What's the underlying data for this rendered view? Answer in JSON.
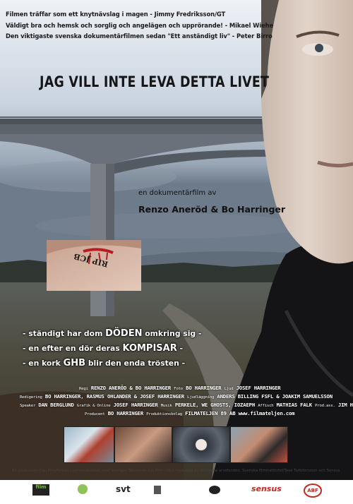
{
  "poster": {
    "quotes": [
      "Filmen träffar som ett knytnävslag i magen - Jimmy Fredriksson/GT",
      "Väldigt bra och hemsk och sorglig och angelägen och upprörande! - Mikael Wiehe",
      "Den viktigaste svenska dokumentärfilmen sedan \"Ett anständigt liv\" - Peter Birro"
    ],
    "title": "Jag vill inte leva detta livet",
    "subtitle": "en dokumentärfilm av",
    "directors": "Renzo Aneröd & Bo Harringer",
    "tattoo_text": "RIP JCB",
    "taglines": [
      {
        "pre": "- ständigt har dom ",
        "hl": "DÖDEN",
        "post": " omkring sig -"
      },
      {
        "pre": "- en efter en dör deras ",
        "hl": "KOMPISAR",
        "post": " -"
      },
      {
        "pre": "- en kork ",
        "hl": "GHB",
        "post": " blir den enda trösten -"
      }
    ],
    "credits": {
      "line1": [
        {
          "role": "Regi",
          "name": "RENZO ANERÖD & BO HARRINGER"
        },
        {
          "role": "Foto",
          "name": "BO HARRINGER"
        },
        {
          "role": "Ljud",
          "name": "JOSEF HARRINGER"
        }
      ],
      "line2": [
        {
          "role": "Redigering",
          "name": "BO HARRINGER, RASMUS OHLANDER & JOSEF HARRINGER"
        },
        {
          "role": "Ljudläggning",
          "name": "ANDERS BILLING FSFL & JOAKIM SAMUELSSON"
        }
      ],
      "line3": [
        {
          "role": "Speaker",
          "name": "DAN BERGLUND"
        },
        {
          "role": "Grafik & Online",
          "name": "JOSEF HARRINGER"
        },
        {
          "role": "Musik",
          "name": "PERKELE, WE GHOSTS, IOZAEPH"
        },
        {
          "role": "Affisch",
          "name": "MATHIAS FALK"
        },
        {
          "role": "Prod.ass.",
          "name": "JIM HARRINGER"
        }
      ],
      "line4": [
        {
          "role": "Producent",
          "name": "BO HARRINGER"
        },
        {
          "role": "Produktionsbolag",
          "name": "FILMATELJEN 89 AB www.filmateljen.com"
        }
      ]
    },
    "footer": "En produktion från FilmAteljén i samproduktion med Sveriges Television och Film i Väst med stöd av Allmänna arvsfonden, Svenska filminstitutet/Tove Torbiörnsson och Sensus.",
    "logos": [
      "film",
      "svt",
      "sensus",
      "ABF"
    ]
  }
}
